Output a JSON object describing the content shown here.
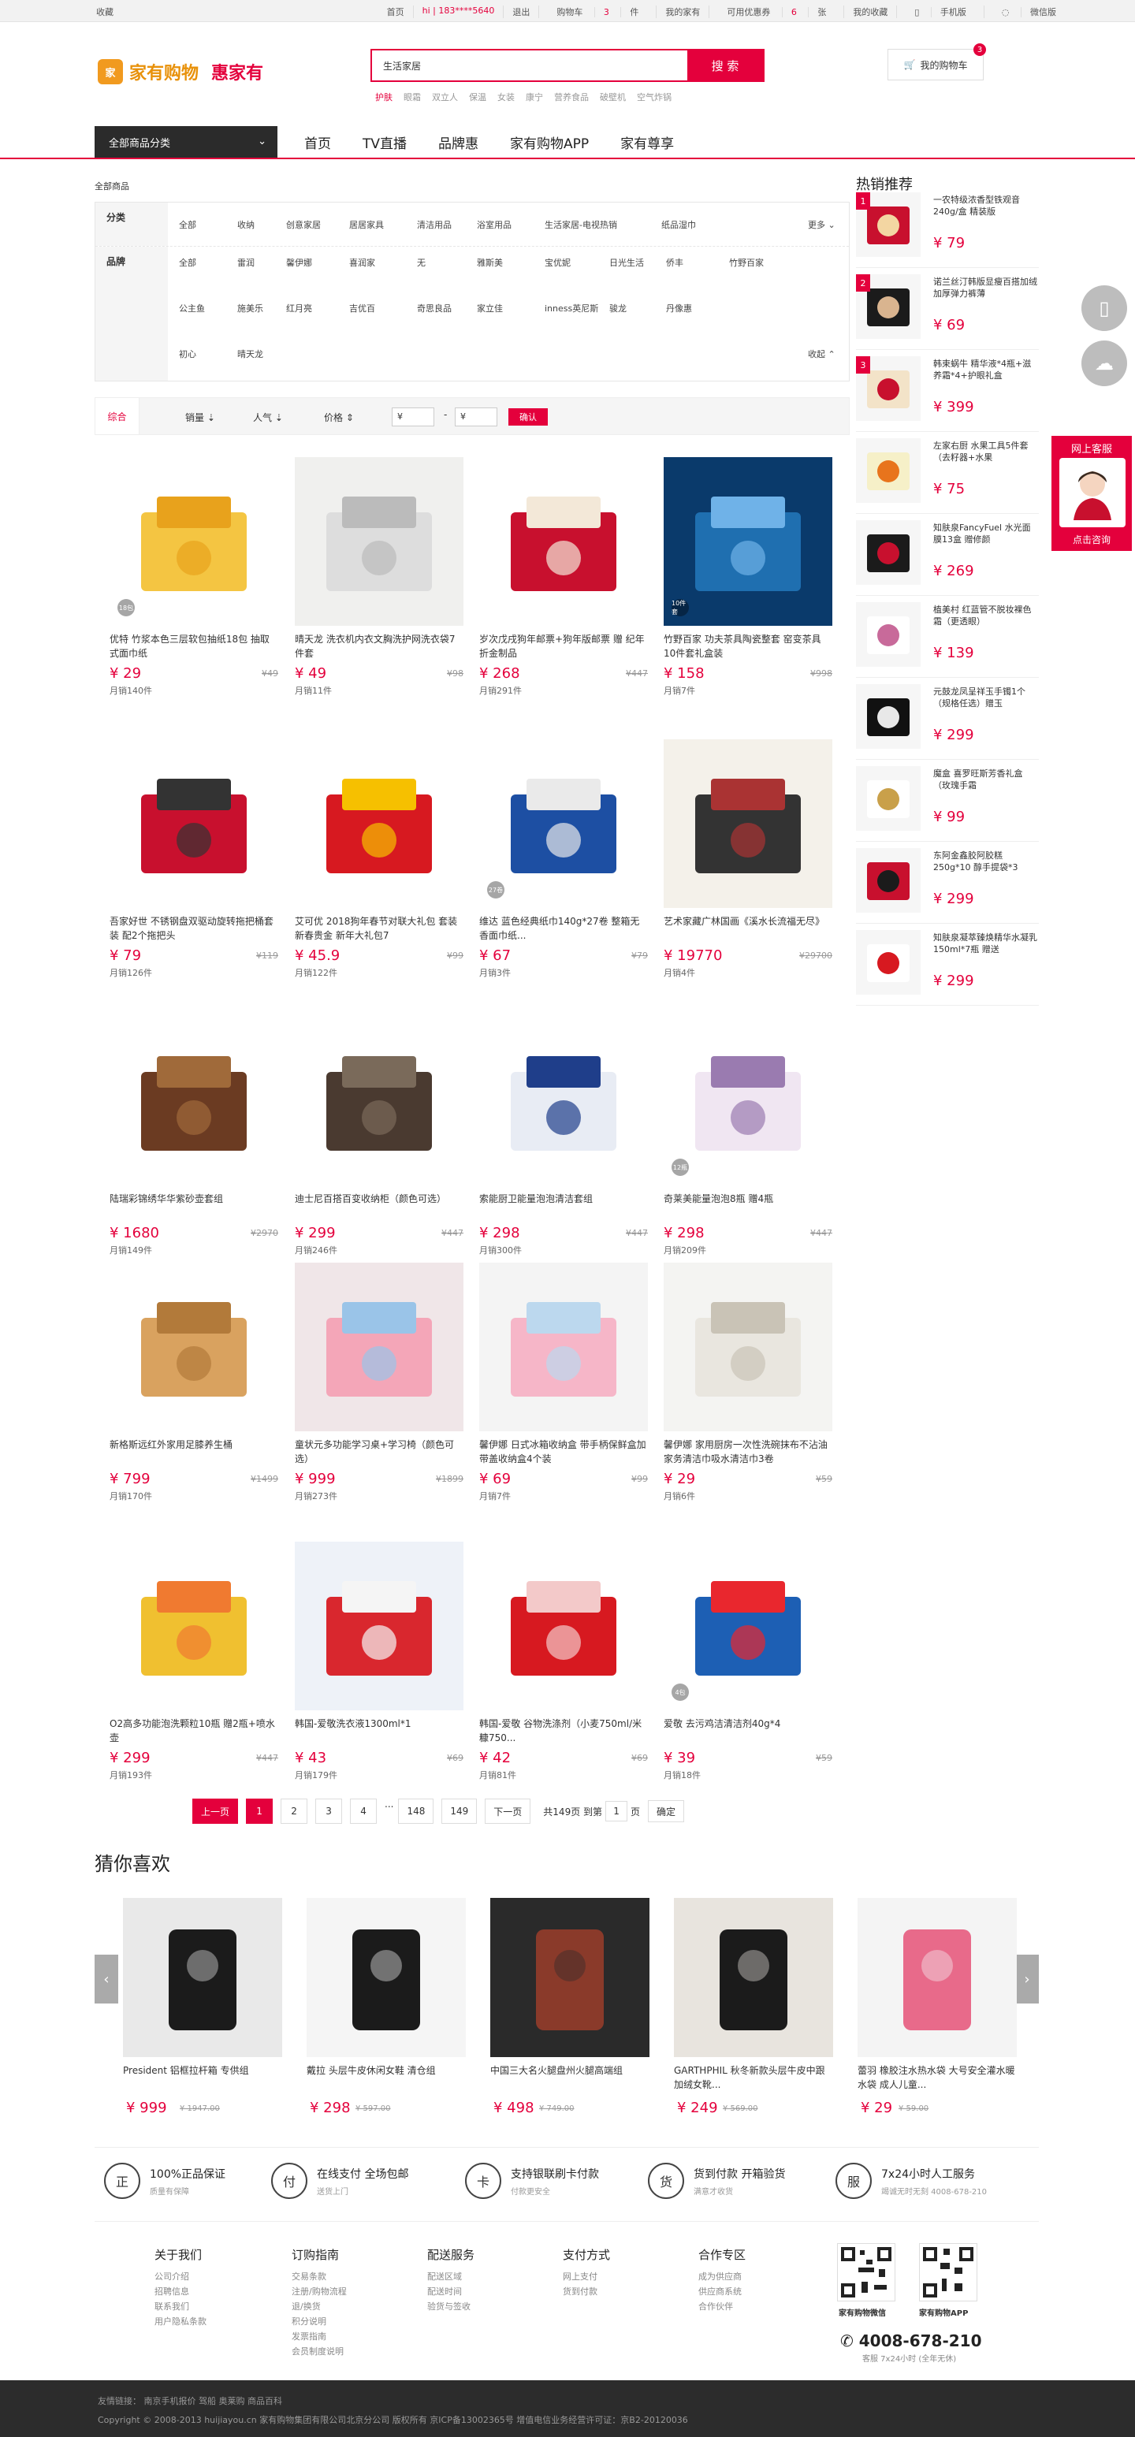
{
  "topbar": {
    "favorite": "收藏",
    "home": "首页",
    "greeting": "hi | 183****5640",
    "logout": "退出",
    "cart": "购物车",
    "cart_count": "3",
    "cart_unit": "件",
    "my_home": "我的家有",
    "coupon": "可用优惠券",
    "coupon_count": "6",
    "coupon_unit": "张",
    "my_fav": "我的收藏",
    "mobile": "手机版",
    "weibo": "微信版"
  },
  "header": {
    "logo_main": "家有购物",
    "logo_sub": "惠家有",
    "search_value": "生活家居",
    "search_button": "搜 索",
    "hotwords": [
      "护肤",
      "眼霜",
      "双立人",
      "保温",
      "女装",
      "康宁",
      "营养食品",
      "破壁机",
      "空气炸锅"
    ],
    "cart_label": "我的购物车",
    "cart_badge": "3"
  },
  "nav": {
    "all_categories": "全部商品分类",
    "items": [
      "首页",
      "TV直播",
      "品牌惠",
      "家有购物APP",
      "家有尊享"
    ]
  },
  "filter": {
    "crumb": "全部商品",
    "category_label": "分类",
    "categories": [
      "全部",
      "收纳",
      "创意家居",
      "居居家具",
      "清洁用品",
      "浴室用品",
      "生活家居-电视热销",
      "纸品湿巾"
    ],
    "more": "更多",
    "brand_label": "品牌",
    "brands_row1": [
      "全部",
      "雷润",
      "馨伊娜",
      "喜润家",
      "无",
      "雅斯美",
      "宝优妮",
      "日光生活",
      "侨丰",
      "竹野百家"
    ],
    "brands_row2": [
      "公主鱼",
      "施美乐",
      "红月亮",
      "吉优百",
      "奇思良品",
      "家立佳",
      "inness英尼斯",
      "骏龙",
      "丹像惠"
    ],
    "brands_row3": [
      "初心",
      "晴天龙"
    ],
    "collapse": "收起"
  },
  "sortbar": {
    "default": "综合",
    "sales": "销量",
    "popularity": "人气",
    "price": "价格",
    "price_from": "¥",
    "dash": "-",
    "price_to": "¥",
    "confirm": "确认"
  },
  "products": [
    {
      "name": "优特 竹浆本色三层软包抽纸18包 抽取式面巾纸",
      "price": "¥ 29",
      "old": "¥49",
      "sold": "月销140件",
      "tag": "18包"
    },
    {
      "name": "晴天龙 洗衣机内衣文胸洗护网洗衣袋7件套",
      "price": "¥ 49",
      "old": "¥98",
      "sold": "月销11件",
      "tag": ""
    },
    {
      "name": "岁次戊戌狗年邮票+狗年版邮票 赠 纪年折金制品",
      "price": "¥ 268",
      "old": "¥447",
      "sold": "月销291件",
      "tag": ""
    },
    {
      "name": "竹野百家 功夫茶具陶瓷整套 窑变茶具10件套礼盒装",
      "price": "¥ 158",
      "old": "¥998",
      "sold": "月销7件",
      "tag": "10件套"
    },
    {
      "name": "吾家好世 不锈钢盘双驱动旋转拖把桶套装 配2个拖把头",
      "price": "¥ 79",
      "old": "¥119",
      "sold": "月销126件",
      "tag": ""
    },
    {
      "name": "艾可优 2018狗年春节对联大礼包 套装新春贵金 新年大礼包7",
      "price": "¥ 45.9",
      "old": "¥99",
      "sold": "月销122件",
      "tag": ""
    },
    {
      "name": "维达 蓝色经典纸巾140g*27卷 整箱无香面巾纸...",
      "price": "¥ 67",
      "old": "¥79",
      "sold": "月销3件",
      "tag": "27卷"
    },
    {
      "name": "艺术家藏广林国画《溪水长流福无尽》",
      "price": "¥ 19770",
      "old": "¥29700",
      "sold": "月销4件",
      "tag": ""
    },
    {
      "name": "陆瑞彩锦绣华华紫砂壶套组",
      "price": "¥ 1680",
      "old": "¥2970",
      "sold": "月销149件",
      "tag": ""
    },
    {
      "name": "迪士尼百搭百变收纳柜（颜色可选）",
      "price": "¥ 299",
      "old": "¥447",
      "sold": "月销246件",
      "tag": ""
    },
    {
      "name": "索能厨卫能量泡泡清洁套组",
      "price": "¥ 298",
      "old": "¥447",
      "sold": "月销300件",
      "tag": ""
    },
    {
      "name": "奇莱美能量泡泡8瓶 赠4瓶",
      "price": "¥ 298",
      "old": "¥447",
      "sold": "月销209件",
      "tag": "12瓶"
    },
    {
      "name": "新格斯远红外家用足膝养生桶",
      "price": "¥ 799",
      "old": "¥1499",
      "sold": "月销170件",
      "tag": ""
    },
    {
      "name": "童状元多功能学习桌+学习椅（颜色可选）",
      "price": "¥ 999",
      "old": "¥1899",
      "sold": "月销273件",
      "tag": ""
    },
    {
      "name": "馨伊娜 日式冰箱收纳盒 带手柄保鲜盒加带盖收纳盒4个装",
      "price": "¥ 69",
      "old": "¥99",
      "sold": "月销7件",
      "tag": ""
    },
    {
      "name": "馨伊娜 家用厨房一次性洗碗抹布不沾油家务清洁巾吸水清洁巾3卷",
      "price": "¥ 29",
      "old": "¥59",
      "sold": "月销6件",
      "tag": ""
    },
    {
      "name": "O2高多功能泡洗颗粒10瓶 赠2瓶+喷水壶",
      "price": "¥ 299",
      "old": "¥447",
      "sold": "月销193件",
      "tag": ""
    },
    {
      "name": "韩国-爱敬洗衣液1300ml*1",
      "price": "¥ 43",
      "old": "¥69",
      "sold": "月销179件",
      "tag": ""
    },
    {
      "name": "韩国-爱敬 谷物洗涤剂（小麦750ml/米糠750...",
      "price": "¥ 42",
      "old": "¥69",
      "sold": "月销81件",
      "tag": ""
    },
    {
      "name": "爱敬 去污鸡洁清洁剂40g*4",
      "price": "¥ 39",
      "old": "¥59",
      "sold": "月销18件",
      "tag": "4包"
    }
  ],
  "pagination": {
    "prev": "上一页",
    "pages": [
      "1",
      "2",
      "3",
      "4",
      "...",
      "148",
      "149"
    ],
    "next": "下一页",
    "total": "共149页 到第",
    "page_input": "1",
    "page_unit": "页",
    "confirm": "确定"
  },
  "hot": {
    "title": "热销推荐",
    "items": [
      {
        "rank": "1",
        "name": "一农特级浓香型铁观音240g/盒 精装版",
        "price": "¥ 79"
      },
      {
        "rank": "2",
        "name": "诺兰丝汀韩版显瘦百搭加绒加厚弹力裤薄",
        "price": "¥ 69"
      },
      {
        "rank": "3",
        "name": "韩束蜗牛 精华液*4瓶+滋养霜*4+护眼礼盒",
        "price": "¥ 399"
      },
      {
        "rank": "",
        "name": "左家右厨 水果工具5件套（去籽器+水果",
        "price": "¥ 75"
      },
      {
        "rank": "",
        "name": "知肤泉FancyFuel 水光面膜13盒 赠修颜",
        "price": "¥ 269"
      },
      {
        "rank": "",
        "name": "植美村 红蓝管不脱妆裸色霜（更透眼）",
        "price": "¥ 139"
      },
      {
        "rank": "",
        "name": "元鼓龙凤呈祥玉手镯1个（规格任选）赠玉",
        "price": "¥ 299"
      },
      {
        "rank": "",
        "name": "魔盒 喜罗旺斯芳香礼盒（玫瑰手霜",
        "price": "¥ 99"
      },
      {
        "rank": "",
        "name": "东阿金鑫胶阿胶糕250g*10 醇手提袋*3",
        "price": "¥ 299"
      },
      {
        "rank": "",
        "name": "知肤泉凝萃臻焕精华水凝乳150ml*7瓶 赠送",
        "price": "¥ 299"
      }
    ]
  },
  "service": {
    "title": "网上客服",
    "button": "点击咨询"
  },
  "guess": {
    "title": "猜你喜欢",
    "items": [
      {
        "name": "President 铝框拉杆箱 专供组",
        "price": "¥ 999",
        "old": "¥ 1947.00"
      },
      {
        "name": "戴拉 头层牛皮休闲女鞋 清仓组",
        "price": "¥ 298",
        "old": "¥ 597.00"
      },
      {
        "name": "中国三大名火腿盘州火腿高端组",
        "price": "¥ 498",
        "old": "¥ 749.00"
      },
      {
        "name": "GARTHPHIL 秋冬新款头层牛皮中跟加绒女靴...",
        "price": "¥ 249",
        "old": "¥ 569.00"
      },
      {
        "name": "蕾羽 橡胶注水热水袋 大号安全灌水暖水袋 成人儿童...",
        "price": "¥ 29",
        "old": "¥ 59.00"
      }
    ]
  },
  "guarantees": [
    {
      "icon": "正",
      "title": "100%正品保证",
      "sub": "质量有保障"
    },
    {
      "icon": "付",
      "title": "在线支付 全场包邮",
      "sub": "送货上门"
    },
    {
      "icon": "卡",
      "title": "支持银联刷卡付款",
      "sub": "付款更安全"
    },
    {
      "icon": "货",
      "title": "货到付款 开箱验货",
      "sub": "满意才收货"
    },
    {
      "icon": "服",
      "title": "7x24小时人工服务",
      "sub": "竭诚无时无刻 4008-678-210"
    }
  ],
  "footer": {
    "cols": [
      {
        "title": "关于我们",
        "links": [
          "公司介绍",
          "招聘信息",
          "联系我们",
          "用户隐私条款"
        ]
      },
      {
        "title": "订购指南",
        "links": [
          "交易条款",
          "注册/购物流程",
          "退/换货",
          "积分说明",
          "发票指南",
          "会员制度说明"
        ]
      },
      {
        "title": "配送服务",
        "links": [
          "配送区域",
          "配送时间",
          "验货与签收"
        ]
      },
      {
        "title": "支付方式",
        "links": [
          "网上支付",
          "货到付款"
        ]
      },
      {
        "title": "合作专区",
        "links": [
          "成为供应商",
          "供应商系统",
          "合作伙伴"
        ]
      }
    ],
    "qr1": "家有购物微信",
    "qr2": "家有购物APP",
    "phone": "4008-678-210",
    "phone_sub": "客服 7x24小时 (全年无休)"
  },
  "bottom": {
    "links": "友情链接： 南京手机报价 驾船 奥莱购 商品百科",
    "copyright": "Copyright © 2008-2013 huijiayou.cn 家有购物集团有限公司北京分公司 版权所有 京ICP备13002365号 增值电信业务经营许可证：京B2-20120036"
  },
  "colors": {
    "accent": "#e4003c",
    "dark": "#2b2b2b"
  }
}
